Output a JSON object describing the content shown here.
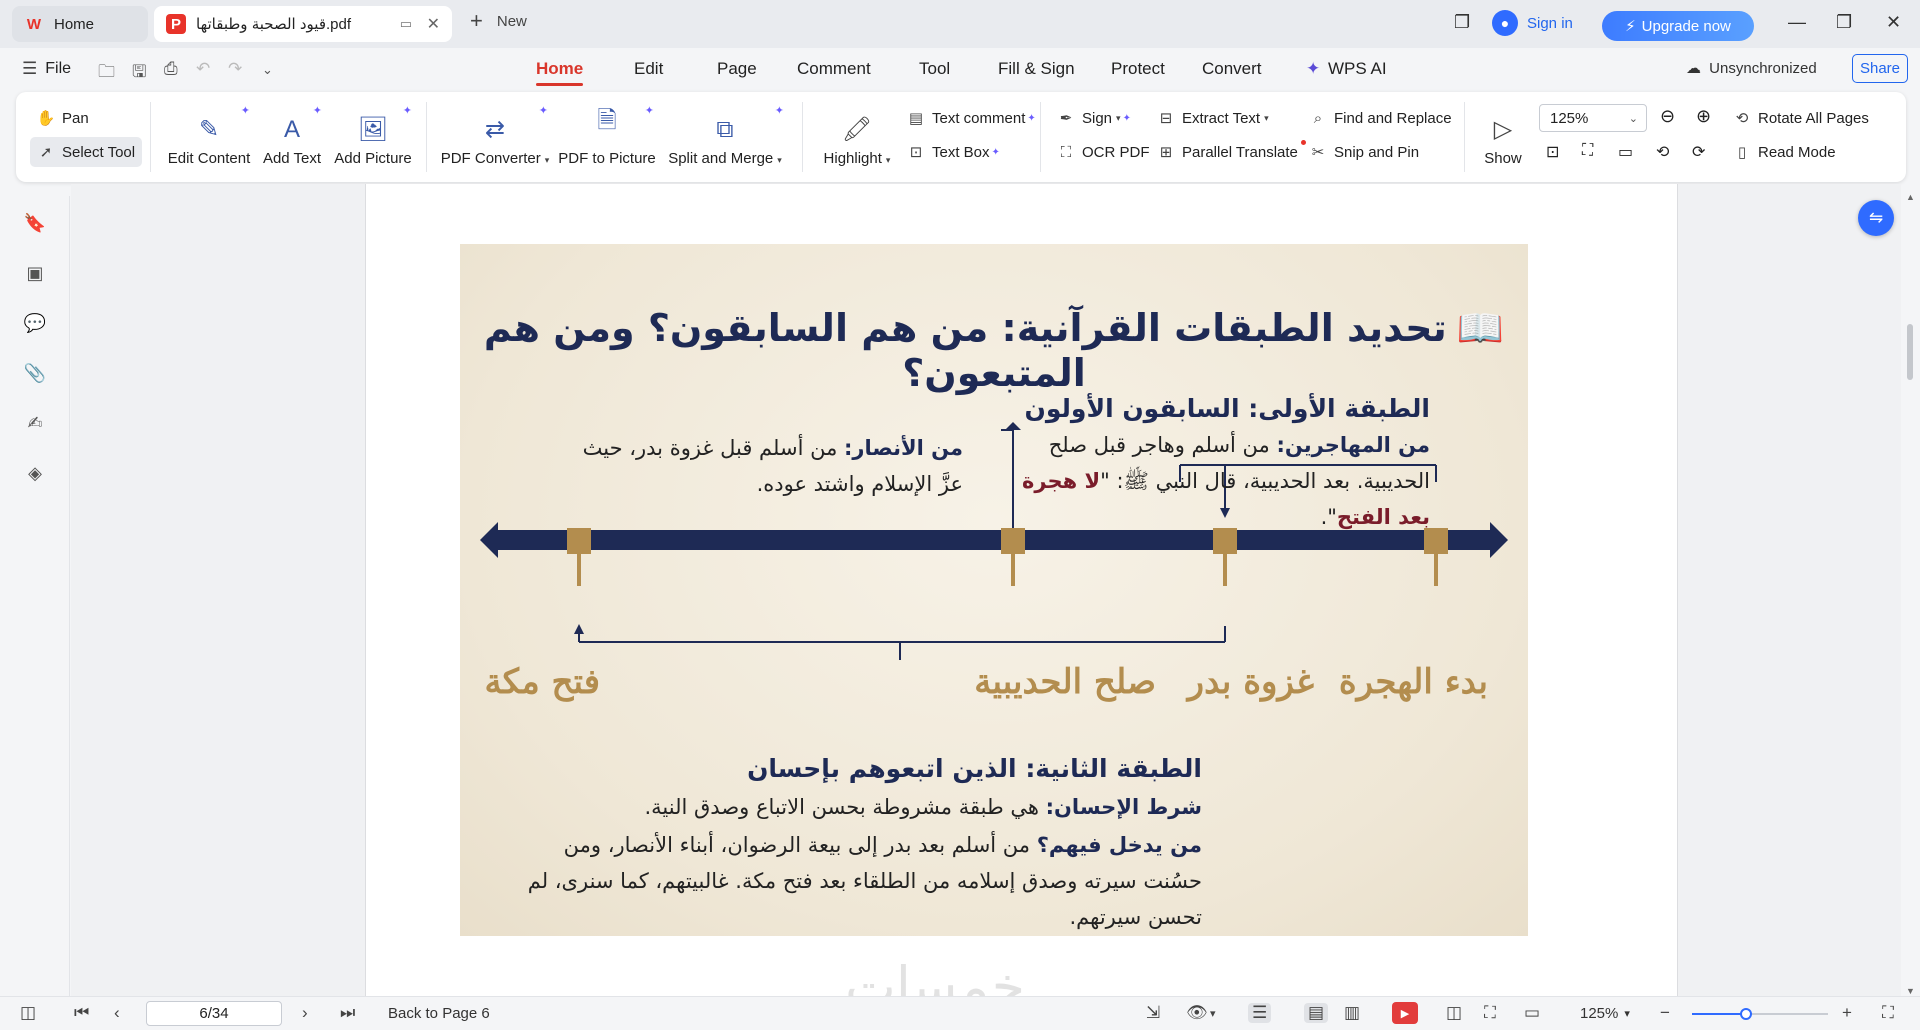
{
  "titlebar": {
    "home_tab": "Home",
    "doc_tab": "قيود الصحبة وطبقاتها.pdf",
    "new_tab": "New",
    "sign_in": "Sign in",
    "upgrade": "Upgrade now"
  },
  "menubar": {
    "file": "File",
    "tabs": [
      "Home",
      "Edit",
      "Page",
      "Comment",
      "Tool",
      "Fill & Sign",
      "Protect",
      "Convert",
      "WPS AI"
    ],
    "active_tab": "Home",
    "sync_status": "Unsynchronized",
    "share": "Share"
  },
  "ribbon": {
    "pan": "Pan",
    "select_tool": "Select Tool",
    "edit_content": "Edit Content",
    "add_text": "Add Text",
    "add_picture": "Add Picture",
    "pdf_converter": "PDF Converter",
    "pdf_to_picture": "PDF to Picture",
    "split_merge": "Split and Merge",
    "highlight": "Highlight",
    "text_comment": "Text comment",
    "text_box": "Text Box",
    "sign": "Sign",
    "ocr_pdf": "OCR PDF",
    "extract_text": "Extract Text",
    "parallel_translate": "Parallel Translate",
    "find_replace": "Find and Replace",
    "snip_pin": "Snip and Pin",
    "show": "Show",
    "zoom": "125%",
    "rotate_all": "Rotate All Pages",
    "read_mode": "Read Mode"
  },
  "poster": {
    "title": "تحديد الطبقات القرآنية: من هم السابقون؟ ومن هم المتبعون؟",
    "layer1_heading": "الطبقة الأولى: السابقون الأولون",
    "muhajirin_label": "من المهاجرين:",
    "muhajirin_text": "من أسلم وهاجر قبل صلح الحديبية. بعد الحديبية، قال النبي ﷺ: \"",
    "muhajirin_quote": "لا هجرة بعد الفتح",
    "muhajirin_end": "\".",
    "ansar_label": "من الأنصار:",
    "ansar_text": "من أسلم قبل غزوة بدر، حيث عزَّ الإسلام واشتد عوده.",
    "events": [
      "بدء الهجرة",
      "غزوة بدر",
      "صلح الحديبية",
      "فتح مكة"
    ],
    "layer2_heading": "الطبقة الثانية: الذين اتبعوهم بإحسان",
    "condition_label": "شرط الإحسان:",
    "condition_text": "هي طبقة مشروطة بحسن الاتباع وصدق النية.",
    "who_label": "من يدخل فيهم؟",
    "who_text": "من أسلم بعد بدر إلى بيعة الرضوان، أبناء الأنصار، ومن حسُنت سيرته وصدق إسلامه من الطلقاء بعد فتح مكة. غالبيتهم، كما سنرى، لم تحسن سيرتهم.",
    "colors": {
      "navy": "#1e2a55",
      "gold": "#b38d4e",
      "maroon": "#7a1c2a"
    }
  },
  "watermark": "خمسات",
  "statusbar": {
    "page": "6/34",
    "back_to_page": "Back to Page 6",
    "zoom": "125%",
    "zoom_fraction": 0.4
  }
}
